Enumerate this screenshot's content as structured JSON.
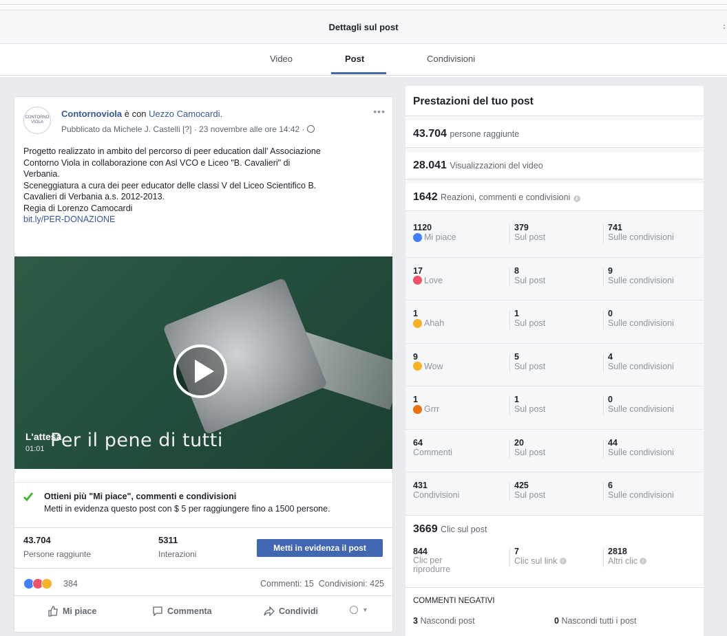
{
  "header": {
    "title": "Dettagli sul post"
  },
  "tabs": [
    {
      "label": "Video"
    },
    {
      "label": "Post"
    },
    {
      "label": "Condivisioni"
    }
  ],
  "post": {
    "page_name": "Contornoviola",
    "with_text": "è con",
    "tagged": "Uezzo Camocardi.",
    "meta": "Pubblicato da Michele J. Castelli [?] · 23 novembre alle ore 14:42 ·",
    "avatar_text": "CONTORNO VIOLA",
    "text_lines": [
      "Progetto realizzato in ambito del percorso di peer education dall' Associazione",
      "Contorno Viola in collaborazione con Asl VCO e Liceo \"B. Cavalieri\" di",
      "Verbania.",
      "Sceneggiatura a cura dei peer educator delle classi V del Liceo Scientifico B.",
      "Cavalieri di Verbania a.s. 2012-2013.",
      "Regia di Lorenzo Camocardi"
    ],
    "link": "bit.ly/PER-DONAZIONE",
    "video": {
      "overlay": "Per il pene di tutti",
      "title": "L'attesa",
      "duration": "01:01"
    },
    "boost": {
      "title": "Ottieni più \"Mi piace\", commenti e condivisioni",
      "subtitle": "Metti in evidenza questo post con $ 5 per raggiungere fino a 1500 persone."
    },
    "stats": {
      "reach_value": "43.704",
      "reach_label": "Persone raggiunte",
      "interactions_value": "5311",
      "interactions_label": "Interazioni",
      "boost_button": "Metti in evidenza il post"
    },
    "reactions": {
      "count": "384",
      "comments": "Commenti: 15",
      "shares": "Condivisioni: 425"
    },
    "actions": {
      "like": "Mi piace",
      "comment": "Commenta",
      "share": "Condividi"
    }
  },
  "performance": {
    "title": "Prestazioni del tuo post",
    "reach": {
      "value": "43.704",
      "label": "persone raggiunte"
    },
    "views": {
      "value": "28.041",
      "label": "Visualizzazioni del video"
    },
    "engagement": {
      "value": "1642",
      "label": "Reazioni, commenti e condivisioni"
    },
    "rows": [
      {
        "total": "1120",
        "label": "Mi piace",
        "on_post": "379",
        "on_post_label": "Sul post",
        "on_shares": "741",
        "on_shares_label": "Sulle condivisioni",
        "icon": "like-icon",
        "color": "#4080ff"
      },
      {
        "total": "17",
        "label": "Love",
        "on_post": "8",
        "on_post_label": "Sul post",
        "on_shares": "9",
        "on_shares_label": "Sulle condivisioni",
        "icon": "love-icon",
        "color": "#f25268"
      },
      {
        "total": "1",
        "label": "Ahah",
        "on_post": "1",
        "on_post_label": "Sul post",
        "on_shares": "0",
        "on_shares_label": "Sulle condivisioni",
        "icon": "haha-icon",
        "color": "#f7b125"
      },
      {
        "total": "9",
        "label": "Wow",
        "on_post": "5",
        "on_post_label": "Sul post",
        "on_shares": "4",
        "on_shares_label": "Sulle condivisioni",
        "icon": "wow-icon",
        "color": "#f7b125"
      },
      {
        "total": "1",
        "label": "Grrr",
        "on_post": "1",
        "on_post_label": "Sul post",
        "on_shares": "0",
        "on_shares_label": "Sulle condivisioni",
        "icon": "angry-icon",
        "color": "#e9710f"
      },
      {
        "total": "64",
        "label": "Commenti",
        "on_post": "20",
        "on_post_label": "Sul post",
        "on_shares": "44",
        "on_shares_label": "Sulle condivisioni",
        "icon": "",
        "color": ""
      },
      {
        "total": "431",
        "label": "Condivisioni",
        "on_post": "425",
        "on_post_label": "Sul post",
        "on_shares": "6",
        "on_shares_label": "Sulle condivisioni",
        "icon": "",
        "color": ""
      }
    ],
    "clicks": {
      "value": "3669",
      "label": "Clic sul post",
      "play_value": "844",
      "play_label_1": "Clic per",
      "play_label_2": "riprodurre",
      "link_value": "7",
      "link_label": "Clic sul link",
      "other_value": "2818",
      "other_label": "Altri clic"
    },
    "negative": {
      "title": "COMMENTI NEGATIVI",
      "hide_post_value": "3",
      "hide_post_label": "Nascondi post",
      "hide_all_value": "0",
      "hide_all_label": "Nascondi tutti i post"
    }
  },
  "colors": {
    "accent": "#4267b2",
    "link": "#365899",
    "check": "#42b72a"
  }
}
